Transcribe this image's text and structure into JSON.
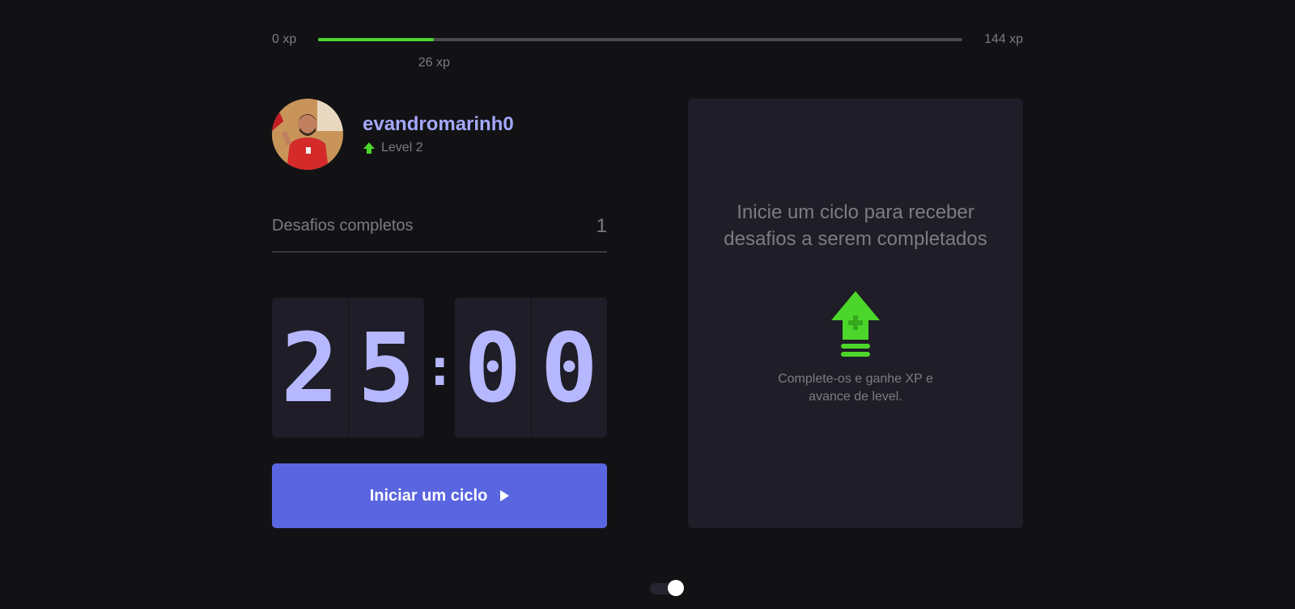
{
  "xp": {
    "min_label": "0 xp",
    "max_label": "144 xp",
    "current_label": "26 xp",
    "current": 26,
    "max": 144,
    "progress_fraction": 0.18,
    "bar_color": "#4cd62b"
  },
  "profile": {
    "username": "evandromarinh0",
    "level_label": "Level 2",
    "level_icon": "level-up-arrow-icon"
  },
  "completed": {
    "label": "Desafios completos",
    "count": "1"
  },
  "countdown": {
    "minute_left": "2",
    "minute_right": "5",
    "separator": ":",
    "second_left": "0",
    "second_right": "0"
  },
  "start_button": {
    "label": "Iniciar um ciclo",
    "icon": "play-icon",
    "color": "#5a65e0"
  },
  "challenge_panel": {
    "title": "Inicie um ciclo para receber desafios a serem completados",
    "icon": "level-up-icon",
    "subtitle": "Complete-os e ganhe XP e avance de level."
  },
  "theme_toggle": {
    "state": "on"
  },
  "colors": {
    "background": "#121214",
    "panel": "#1f1d27",
    "accent_text": "#a4a8ff",
    "green": "#4cd62b"
  }
}
